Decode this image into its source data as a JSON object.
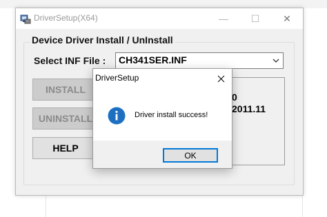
{
  "window": {
    "title": "DriverSetup(X64)",
    "minimize_glyph": "—",
    "maximize_glyph": "☐",
    "close_glyph": "✕"
  },
  "group": {
    "label": "Device Driver Install / UnInstall"
  },
  "inf": {
    "label": "Select INF File :",
    "selected": "CH341SER.INF"
  },
  "buttons": {
    "install": "INSTALL",
    "uninstall": "UNINSTALL",
    "help": "HELP"
  },
  "info_panel": {
    "line1": "0",
    "line2": "2011.11"
  },
  "dialog": {
    "title": "DriverSetup",
    "message": "Driver install success!",
    "ok": "OK"
  },
  "icons": {
    "app": "driver-setup-icon",
    "info": "info-icon",
    "dialog_close": "close-icon",
    "dropdown": "chevron-down-icon"
  },
  "colors": {
    "accent": "#0078d7",
    "window_bg": "#f0f0f0",
    "disabled_text": "#8a8a8a"
  }
}
